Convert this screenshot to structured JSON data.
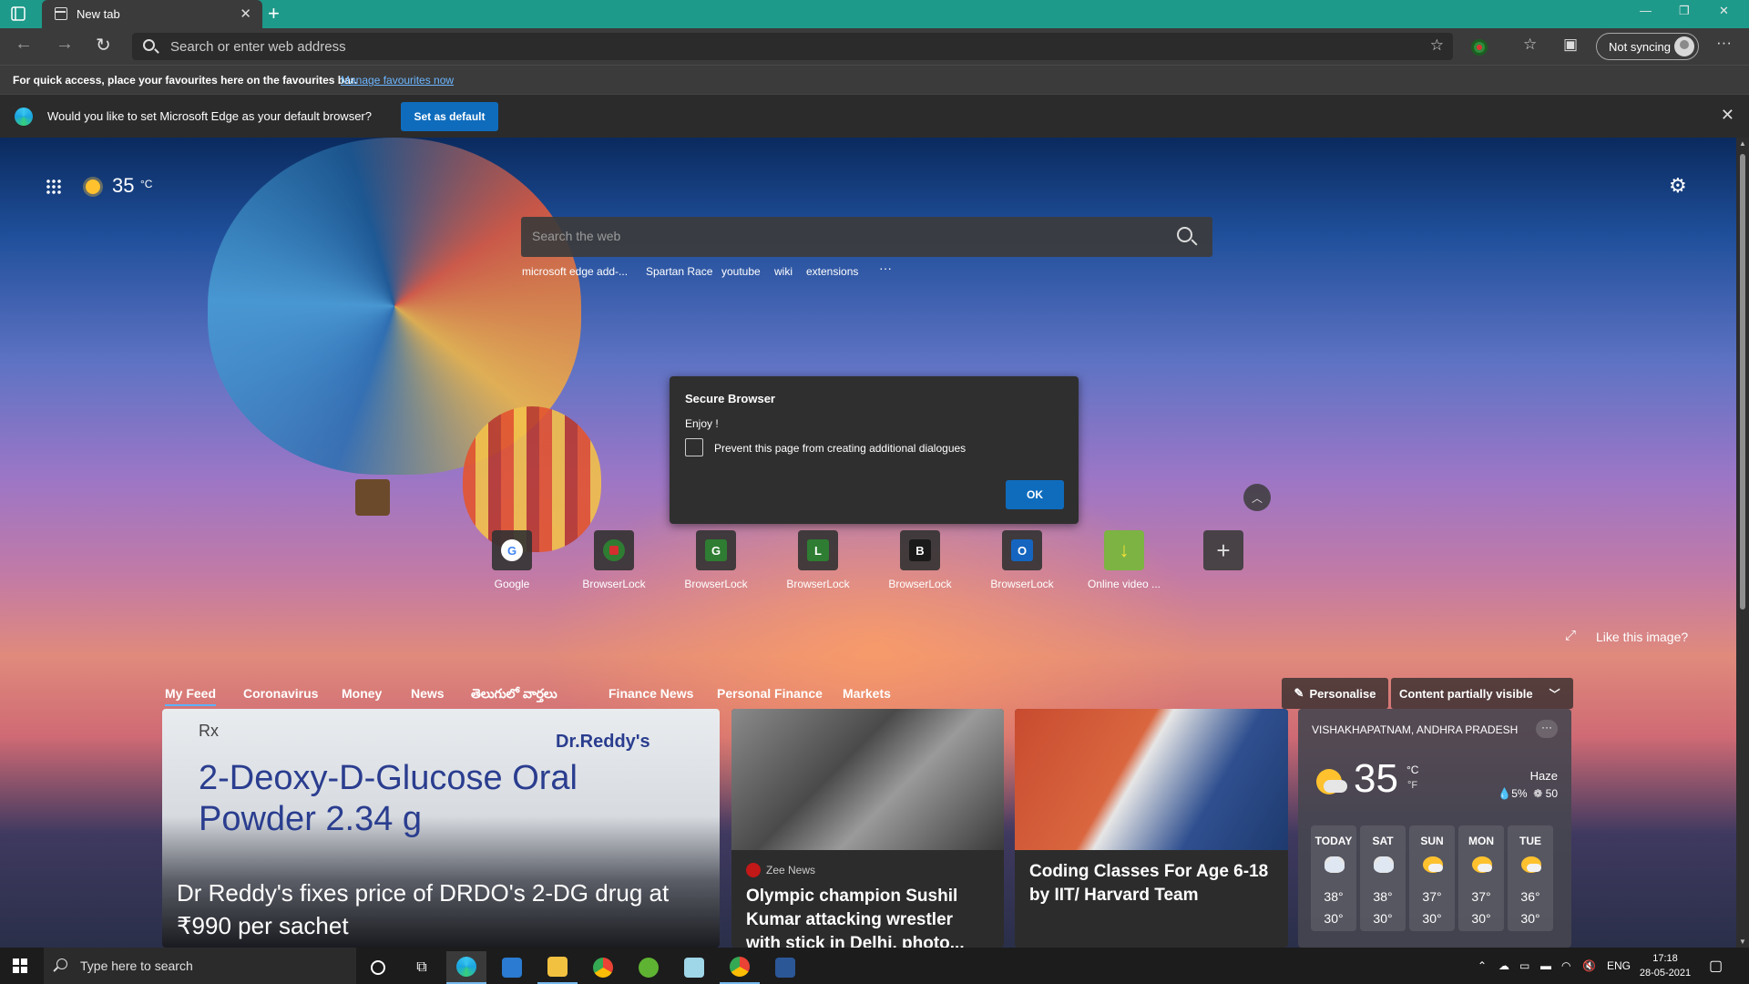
{
  "browser": {
    "tab_title": "New tab",
    "address_placeholder": "Search or enter web address",
    "sync_label": "Not syncing"
  },
  "favourites_bar": {
    "message": "For quick access, place your favourites here on the favourites bar.",
    "link": "Manage favourites now"
  },
  "infobar": {
    "message": "Would you like to set Microsoft Edge as your default browser?",
    "button": "Set as default"
  },
  "weather_widget": {
    "temp": "35",
    "unit": "°C"
  },
  "search": {
    "placeholder": "Search the web",
    "quick_links": [
      "microsoft edge add-...",
      "Spartan Race",
      "youtube",
      "wiki",
      "extensions",
      "···"
    ]
  },
  "dialog": {
    "title": "Secure Browser",
    "message": "Enjoy !",
    "checkbox_label": "Prevent this page from creating additional dialogues",
    "ok": "OK"
  },
  "tiles": [
    {
      "label": "Google",
      "letter": "G",
      "color": "#ffffff",
      "text_color": "#4285f4"
    },
    {
      "label": "BrowserLock",
      "letter": "",
      "color": "#2e7d32",
      "text_color": "#ffffff"
    },
    {
      "label": "BrowserLock",
      "letter": "G",
      "color": "#2e7d32",
      "text_color": "#ffffff"
    },
    {
      "label": "BrowserLock",
      "letter": "L",
      "color": "#2e7d32",
      "text_color": "#ffffff"
    },
    {
      "label": "BrowserLock",
      "letter": "B",
      "color": "#1a1a1a",
      "text_color": "#ffffff"
    },
    {
      "label": "BrowserLock",
      "letter": "O",
      "color": "#1565c0",
      "text_color": "#ffffff"
    },
    {
      "label": "Online video ...",
      "letter": "↓",
      "color": "#7cb342",
      "text_color": "#f9e23a"
    }
  ],
  "like_image": "Like this image?",
  "feed_nav": {
    "items": [
      "My Feed",
      "Coronavirus",
      "Money",
      "News",
      "తెలుగులో వార్తలు",
      "Finance News",
      "Personal Finance",
      "Markets"
    ],
    "personalise": "Personalise",
    "content_visibility": "Content partially visible"
  },
  "cards": {
    "card1": {
      "rx": "Rx",
      "brand": "Dr.Reddy's",
      "product_line1": "2-Deoxy-D-Glucose Oral",
      "product_line2": "Powder 2.34 g",
      "headline": "Dr Reddy's fixes price of DRDO's 2-DG drug at ₹990 per sachet"
    },
    "card2": {
      "source": "Zee News",
      "headline": "Olympic champion Sushil Kumar attacking wrestler with stick in Delhi, photo..."
    },
    "card3": {
      "headline": "Coding Classes For Age 6-18 by IIT/ Harvard Team"
    },
    "weather": {
      "location": "VISHAKHAPATNAM, ANDHRA PRADESH",
      "temp": "35",
      "unit_c": "°C",
      "unit_f": "°F",
      "condition": "Haze",
      "precip": "💧5%",
      "aqi": "50",
      "forecast": [
        {
          "day": "TODAY",
          "hi": "38°",
          "lo": "30°",
          "icon": "cloud"
        },
        {
          "day": "SAT",
          "hi": "38°",
          "lo": "30°",
          "icon": "cloud"
        },
        {
          "day": "SUN",
          "hi": "37°",
          "lo": "30°",
          "icon": "sun"
        },
        {
          "day": "MON",
          "hi": "37°",
          "lo": "30°",
          "icon": "sun"
        },
        {
          "day": "TUE",
          "hi": "36°",
          "lo": "30°",
          "icon": "sun"
        }
      ]
    }
  },
  "taskbar": {
    "search_placeholder": "Type here to search",
    "language": "ENG",
    "time": "17:18",
    "date": "28-05-2021"
  }
}
